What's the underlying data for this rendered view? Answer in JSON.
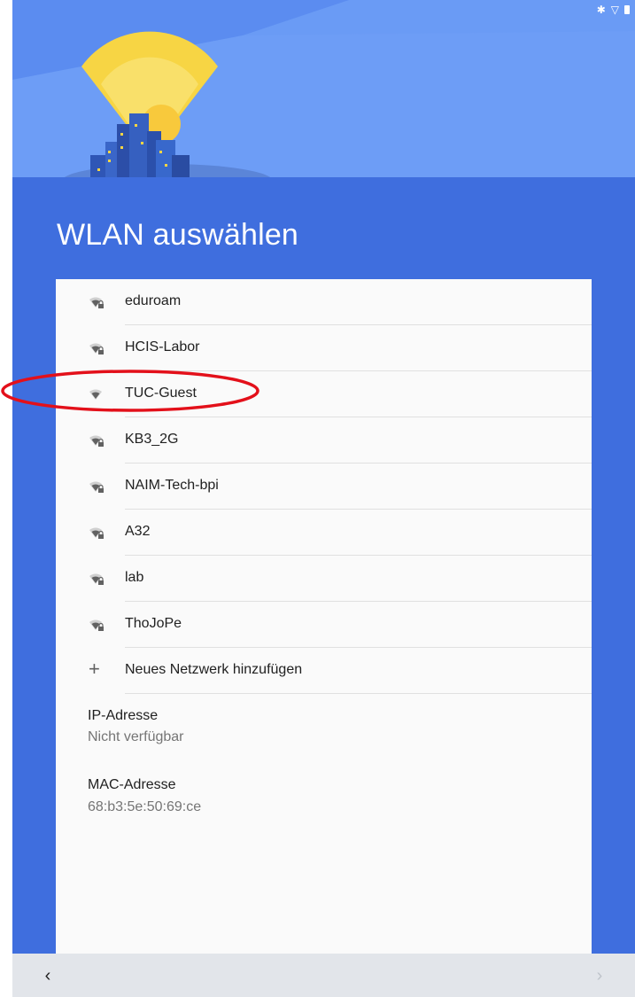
{
  "status_bar": {
    "icons": [
      "bluetooth-icon",
      "wifi-status-icon",
      "battery-icon"
    ]
  },
  "title": "WLAN auswählen",
  "networks": [
    {
      "name": "eduroam",
      "secured": true
    },
    {
      "name": "HCIS-Labor",
      "secured": true
    },
    {
      "name": "TUC-Guest",
      "secured": false
    },
    {
      "name": "KB3_2G",
      "secured": true
    },
    {
      "name": "NAIM-Tech-bpi",
      "secured": true
    },
    {
      "name": "A32",
      "secured": true
    },
    {
      "name": "lab",
      "secured": true
    },
    {
      "name": "ThoJoPe",
      "secured": true
    }
  ],
  "add_network": {
    "label": "Neues Netzwerk hinzufügen",
    "icon": "plus-icon"
  },
  "ip": {
    "label": "IP-Adresse",
    "value": "Nicht verfügbar"
  },
  "mac": {
    "label": "MAC-Adresse",
    "value": "68:b3:5e:50:69:ce"
  },
  "nav": {
    "back_glyph": "‹",
    "next_glyph": "›"
  },
  "colors": {
    "background": "#3f6ede",
    "header_light": "#6a9bf5",
    "card": "#fafafa",
    "highlight": "#e3101a"
  }
}
